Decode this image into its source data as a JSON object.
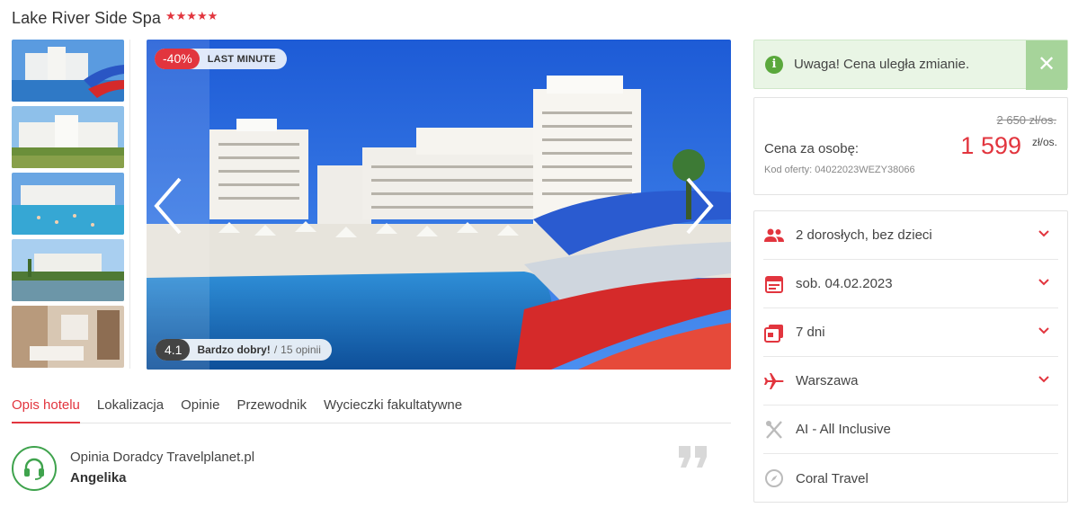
{
  "hotel": {
    "name": "Lake River Side Spa",
    "stars": "★★★★★"
  },
  "gallery": {
    "discount": "-40%",
    "badge": "LAST MINUTE",
    "rating_score": "4.1",
    "rating_label": "Bardzo dobry!",
    "rating_separator": "/",
    "rating_count": "15 opinii",
    "thumbnails": [
      "hotel-pool-slide",
      "hotel-garden",
      "hotel-pool-crowd",
      "hotel-lake",
      "hotel-room"
    ]
  },
  "tabs": [
    "Opis hotelu",
    "Lokalizacja",
    "Opinie",
    "Przewodnik",
    "Wycieczki fakultatywne"
  ],
  "advisor": {
    "title": "Opinia Doradcy Travelplanet.pl",
    "name": "Angelika"
  },
  "alert": {
    "message": "Uwaga! Cena uległa zmianie.",
    "icon": "info-icon",
    "close": "✕"
  },
  "price": {
    "old": "2 650 zł/os.",
    "label": "Cena za osobę:",
    "value": "1 599",
    "unit": "zł/os.",
    "code": "Kod oferty: 04022023WEZY38066"
  },
  "options": [
    {
      "icon": "people-icon",
      "text": "2 dorosłych, bez dzieci",
      "dropdown": true
    },
    {
      "icon": "calendar-icon",
      "text": "sob. 04.02.2023",
      "dropdown": true
    },
    {
      "icon": "duration-icon",
      "text": "7 dni",
      "dropdown": true
    },
    {
      "icon": "plane-icon",
      "text": "Warszawa",
      "dropdown": true
    },
    {
      "icon": "cutlery-icon",
      "text": "AI - All Inclusive",
      "dropdown": false
    },
    {
      "icon": "compass-icon",
      "text": "Coral Travel",
      "dropdown": false
    }
  ],
  "colors": {
    "accent": "#e2353e",
    "success": "#5aa83c",
    "success_bg": "#e9f5e5"
  }
}
